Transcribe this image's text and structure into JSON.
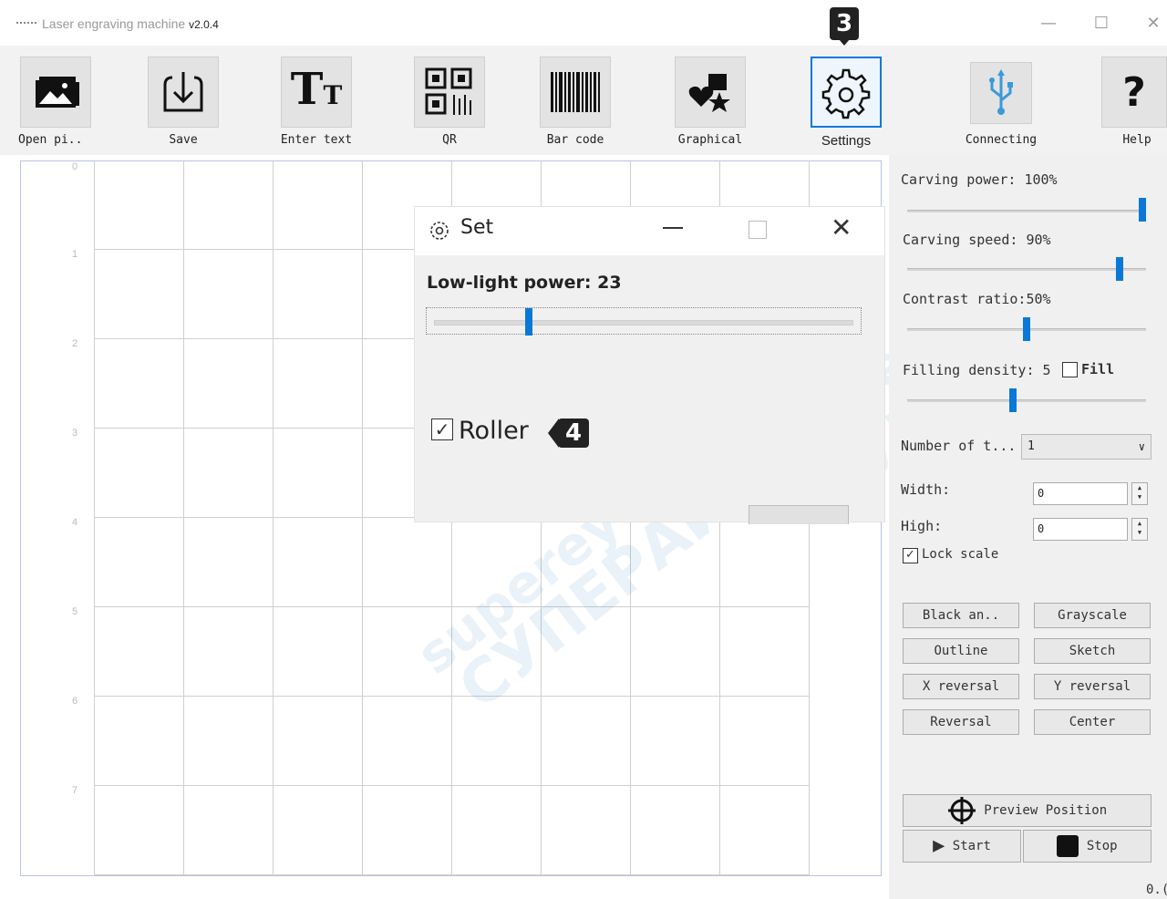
{
  "titlebar": {
    "title": "Laser engraving machine",
    "version": "v2.0.4"
  },
  "toolbar": {
    "items": [
      {
        "label": "Open pi..",
        "icon": "open-picture-icon"
      },
      {
        "label": "Save",
        "icon": "save-download-icon"
      },
      {
        "label": "Enter text",
        "icon": "text-icon"
      },
      {
        "label": "QR",
        "icon": "qr-code-icon"
      },
      {
        "label": "Bar code",
        "icon": "barcode-icon"
      },
      {
        "label": "Graphical",
        "icon": "shapes-icon"
      },
      {
        "label": "Settings",
        "icon": "gear-icon"
      },
      {
        "label": "Connecting",
        "icon": "usb-icon"
      },
      {
        "label": "Help",
        "icon": "question-icon"
      }
    ]
  },
  "annotations": {
    "step3": "3",
    "step4": "4"
  },
  "canvas": {
    "ruler": [
      "0",
      "1",
      "2",
      "3",
      "4",
      "5",
      "6",
      "7"
    ]
  },
  "dialog": {
    "title": "Set",
    "low_light_label": "Low-light power:",
    "low_light_value": "23",
    "low_light_level": 0.23,
    "roller_label": "Roller",
    "roller_checked": true
  },
  "panel": {
    "carving_power": "Carving power: 100%",
    "carving_power_level": 1.0,
    "carving_speed": "Carving speed: 90%",
    "carving_speed_level": 0.9,
    "contrast": "Contrast ratio:50%",
    "contrast_level": 0.5,
    "filling_density": "Filling density: 5",
    "fill_label": "Fill",
    "fill_checked": false,
    "number_label": "Number of t...",
    "number_value": "1",
    "width_label": "Width:",
    "width_value": "0",
    "high_label": "High:",
    "high_value": "0",
    "lock_scale": "Lock scale",
    "lock_checked": true,
    "buttons": [
      "Black an..",
      "Grayscale",
      "Outline",
      "Sketch",
      "X reversal",
      "Y reversal",
      "Reversal",
      "Center"
    ],
    "preview": "Preview Position",
    "start": "Start",
    "stop": "Stop",
    "corner": "0.("
  },
  "watermark": {
    "line1": "supereyes.ru",
    "line2": "СУПЕРАЙС"
  },
  "colors": {
    "accent": "#0a78d7",
    "badge": "#222222"
  }
}
